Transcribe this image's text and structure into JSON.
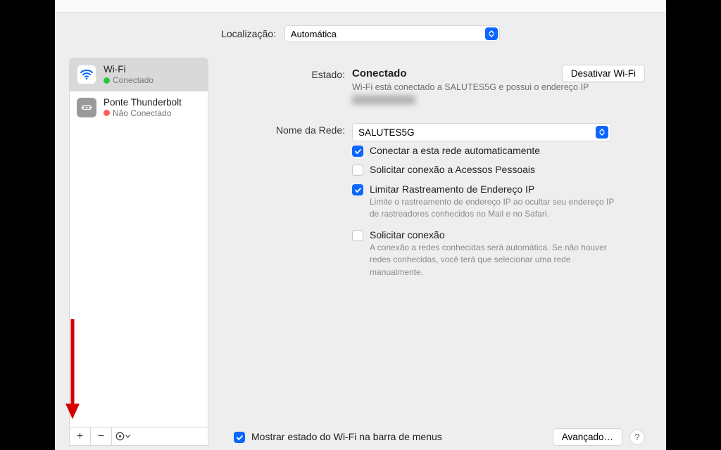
{
  "location": {
    "label": "Localização:",
    "value": "Automática"
  },
  "sidebar": {
    "items": [
      {
        "name": "Wi-Fi",
        "status_label": "Conectado",
        "status_color": "green"
      },
      {
        "name": "Ponte Thunderbolt",
        "status_label": "Não Conectado",
        "status_color": "red"
      }
    ]
  },
  "main": {
    "status_label": "Estado:",
    "status_value": "Conectado",
    "deactivate_label": "Desativar Wi-Fi",
    "sub_status": "Wi-Fi está conectado a SALUTES5G e possui o endereço IP",
    "network_label": "Nome da Rede:",
    "network_value": "SALUTES5G",
    "checkboxes": {
      "auto_connect": {
        "label": "Conectar a esta rede automaticamente",
        "checked": true
      },
      "personal_hotspot": {
        "label": "Solicitar conexão a Acessos Pessoais",
        "checked": false
      },
      "limit_tracking": {
        "label": "Limitar Rastreamento de Endereço IP",
        "desc": "Limite o rastreamento de endereço IP ao ocultar seu endereço IP de rastreadores conhecidos no Mail e no Safari.",
        "checked": true
      },
      "ask_join": {
        "label": "Solicitar conexão",
        "desc": "A conexão a redes conhecidas será automática. Se não houver redes conhecidas, você terá que selecionar uma rede manualmente.",
        "checked": false
      }
    },
    "show_in_menubar": {
      "label": "Mostrar estado do Wi-Fi na barra de menus",
      "checked": true
    },
    "advanced_label": "Avançado…",
    "help_label": "?"
  },
  "toolbar": {
    "add": "+",
    "remove": "−",
    "actions": "⊙"
  }
}
